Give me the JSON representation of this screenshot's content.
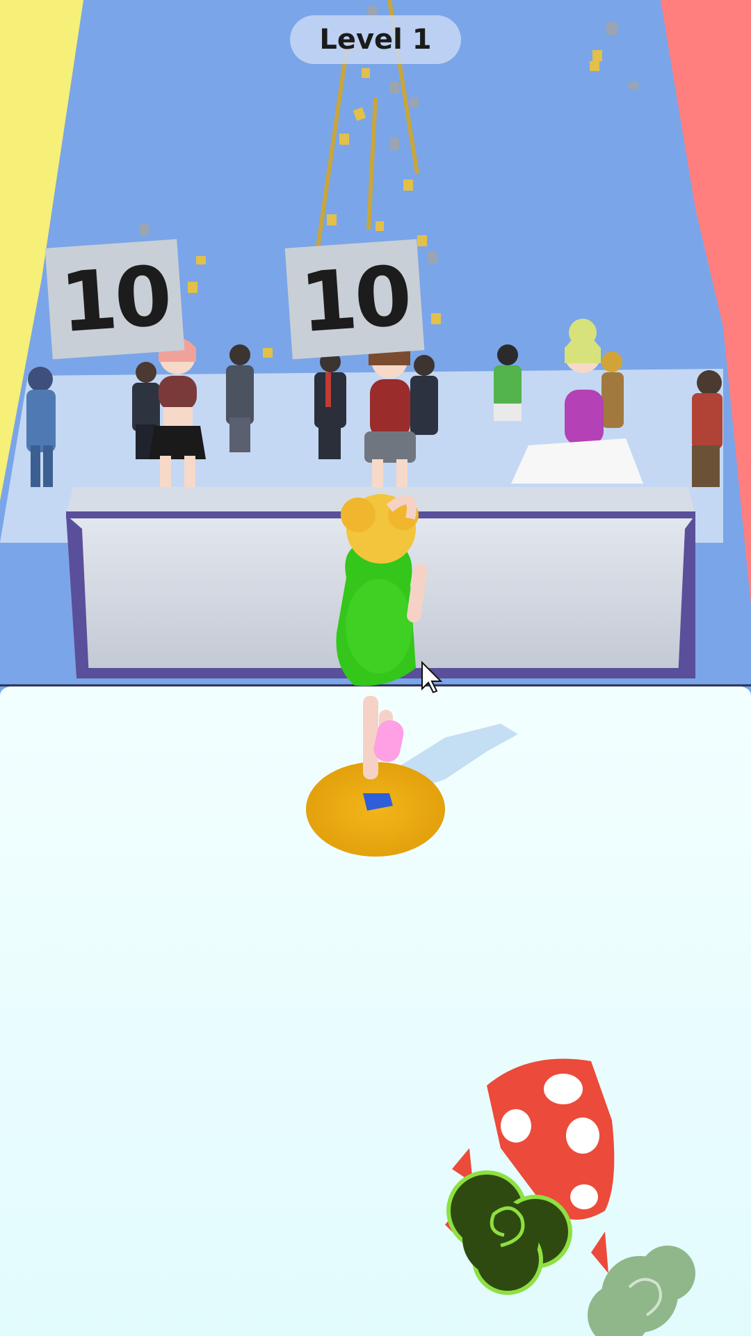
{
  "hud": {
    "level_label": "Level 1"
  },
  "judges": {
    "scores": [
      "10",
      "10"
    ]
  },
  "colors": {
    "wall_back": "#7aa5e8",
    "curtain_left": "#f6ef78",
    "curtain_right": "#ff7f7f",
    "floor": "#e6fdff",
    "table": "#c9cfd9",
    "table_trim": "#5a4f9a",
    "player_dress": "#35c61b",
    "player_hair": "#f3c53c",
    "spotlight": "#e9aa12",
    "mushroom_red": "#ec4a3a",
    "bush_dark": "#2f4a10",
    "bush_light": "#8fb78a"
  },
  "icons": [
    "mouse-cursor-icon"
  ]
}
